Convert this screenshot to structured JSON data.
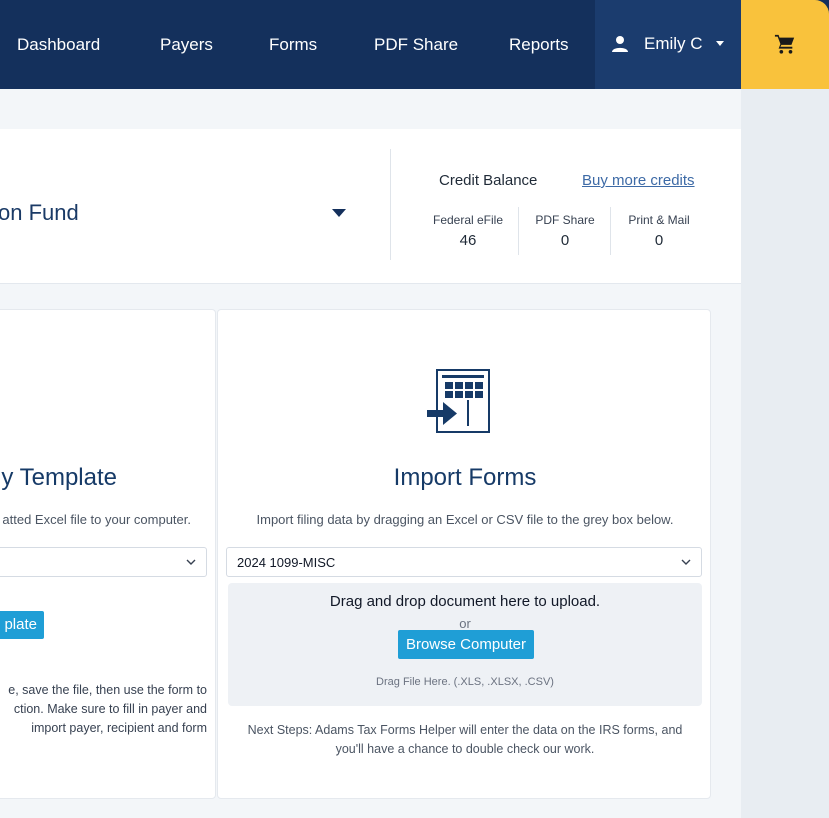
{
  "nav": {
    "items": [
      {
        "label": "Dashboard"
      },
      {
        "label": "Payers"
      },
      {
        "label": "Forms"
      },
      {
        "label": "PDF Share"
      },
      {
        "label": "Reports"
      }
    ],
    "user_name": "Emily C",
    "icons": {
      "user": "user-icon",
      "cart": "cart-icon",
      "caret": "caret-down-icon"
    }
  },
  "header": {
    "payer_name": "on Fund",
    "credit_title": "Credit Balance",
    "buy_credits_link": "Buy more credits",
    "credits": [
      {
        "label": "Federal eFile",
        "value": "46"
      },
      {
        "label": "PDF Share",
        "value": "0"
      },
      {
        "label": "Print & Mail",
        "value": "0"
      }
    ]
  },
  "template_card": {
    "title": "y Template",
    "description": "atted Excel file to your computer.",
    "button_label": "plate",
    "paragraph_lines": [
      "e, save the file, then use the form to",
      "ction. Make sure to fill in payer and",
      "import payer, recipient and form"
    ]
  },
  "import_card": {
    "title": "Import Forms",
    "description": "Import filing data by dragging an Excel or CSV file to the grey box below.",
    "form_select_value": "2024 1099-MISC",
    "drop_main": "Drag and drop document here to upload.",
    "drop_or": "or",
    "browse_button": "Browse Computer",
    "drop_hint": "Drag File Here. (.XLS, .XLSX, .CSV)",
    "next_steps_line1": "Next Steps: Adams Tax Forms Helper will enter the data on the IRS forms, and",
    "next_steps_line2": "you'll have a chance to double check our work."
  },
  "colors": {
    "nav_bg": "#14305c",
    "user_bg": "#1b3c6e",
    "cart_bg": "#f9c23c",
    "accent_button": "#1f9ed6",
    "title_text": "#163a67",
    "link": "#3d6aa6"
  }
}
